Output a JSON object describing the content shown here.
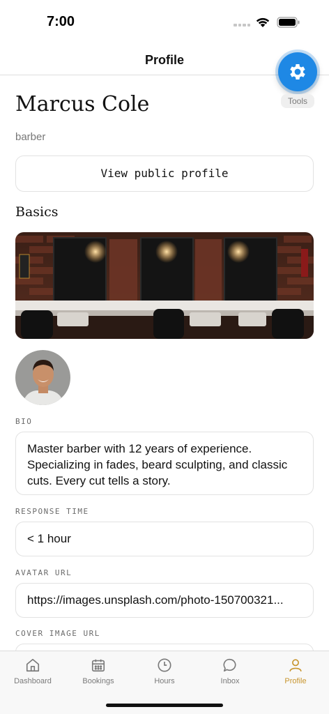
{
  "status_bar": {
    "time": "7:00"
  },
  "header": {
    "title": "Profile"
  },
  "tools": {
    "label": "Tools",
    "icon": "gear-icon",
    "color": "#1e88e5"
  },
  "profile": {
    "name": "Marcus Cole",
    "role": "barber",
    "view_public_label": "View public profile",
    "section_title": "Basics"
  },
  "fields": {
    "bio": {
      "label": "BIO",
      "value": "Master barber with 12 years of experience. Specializing in fades, beard sculpting, and classic cuts. Every cut tells a story."
    },
    "response_time": {
      "label": "RESPONSE TIME",
      "value": "< 1 hour"
    },
    "avatar_url": {
      "label": "AVATAR URL",
      "value": "https://images.unsplash.com/photo-150700321..."
    },
    "cover_image_url": {
      "label": "COVER IMAGE URL",
      "value": ""
    }
  },
  "tabs": [
    {
      "label": "Dashboard",
      "icon": "home-icon"
    },
    {
      "label": "Bookings",
      "icon": "calendar-icon"
    },
    {
      "label": "Hours",
      "icon": "clock-icon"
    },
    {
      "label": "Inbox",
      "icon": "chat-icon"
    },
    {
      "label": "Profile",
      "icon": "person-icon",
      "active": true
    }
  ],
  "colors": {
    "accent": "#c8952e",
    "fab": "#1e88e5",
    "inactive_tab": "#7a7a7a"
  }
}
